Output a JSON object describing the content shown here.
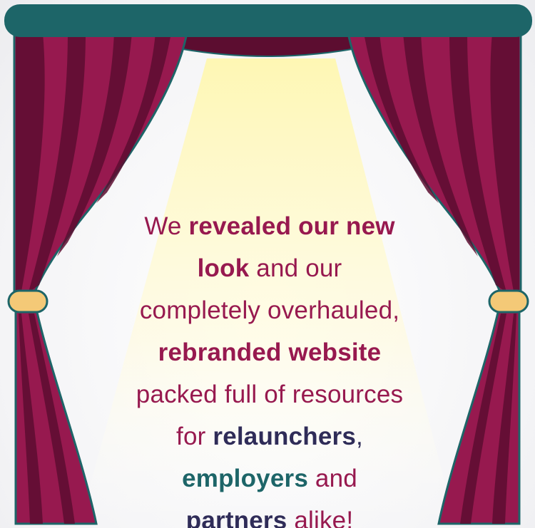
{
  "message": {
    "l1_a": "We ",
    "l1_b": "revealed our new",
    "l2_a": "look",
    "l2_b": " and our",
    "l3": "completely overhauled,",
    "l4": "rebranded website",
    "l5": "packed full of resources",
    "l6_a": "for ",
    "l6_b": "relaunchers",
    "l6_c": ",",
    "l7_a": "employers",
    "l7_b": " and",
    "l8_a": "partners",
    "l8_b": " alike!"
  },
  "colors": {
    "curtain": "#97194f",
    "curtain_shadow": "#5c0d30",
    "rod": "#1d6568",
    "tieback": "#f4c977",
    "spotlight": "#fffbd6",
    "text_plum": "#97194f",
    "text_navy": "#2f2c58",
    "text_teal": "#1d6568"
  }
}
